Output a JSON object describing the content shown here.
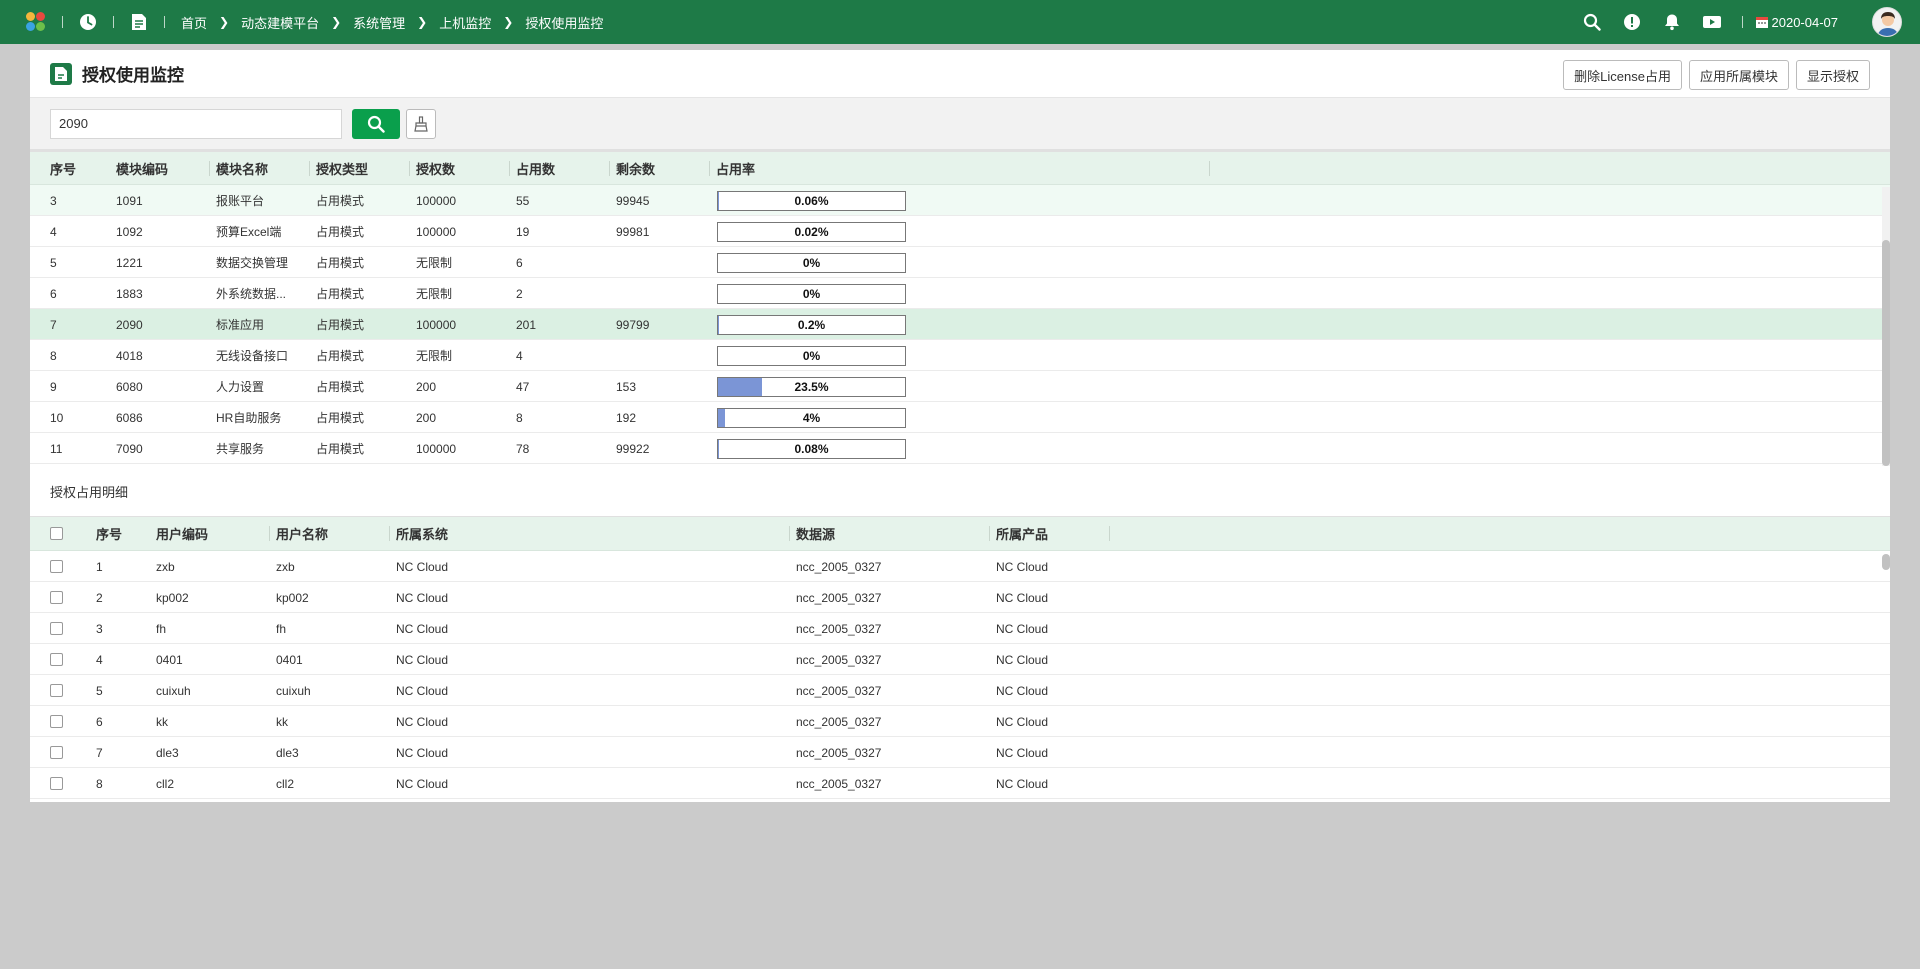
{
  "topbar": {
    "breadcrumbs": [
      "首页",
      "动态建模平台",
      "系统管理",
      "上机监控",
      "授权使用监控"
    ],
    "date": "2020-04-07",
    "icons": [
      "clock-icon",
      "document-icon",
      "search-icon",
      "alert-icon",
      "bell-icon",
      "video-icon",
      "calendar-icon"
    ]
  },
  "header": {
    "title": "授权使用监控",
    "buttons": [
      "删除License占用",
      "应用所属模块",
      "显示授权"
    ]
  },
  "search": {
    "value": "2090"
  },
  "license_table": {
    "columns": [
      "序号",
      "模块编码",
      "模块名称",
      "授权类型",
      "授权数",
      "占用数",
      "剩余数",
      "占用率"
    ],
    "rows": [
      {
        "no": "3",
        "code": "1091",
        "name": "报账平台",
        "type": "占用模式",
        "licensed": "100000",
        "used": "55",
        "remaining": "99945",
        "rate": "0.06%",
        "rate_value": 0.06
      },
      {
        "no": "4",
        "code": "1092",
        "name": "预算Excel端",
        "type": "占用模式",
        "licensed": "100000",
        "used": "19",
        "remaining": "99981",
        "rate": "0.02%",
        "rate_value": 0.02
      },
      {
        "no": "5",
        "code": "1221",
        "name": "数据交换管理",
        "type": "占用模式",
        "licensed": "无限制",
        "used": "6",
        "remaining": "",
        "rate": "0%",
        "rate_value": 0
      },
      {
        "no": "6",
        "code": "1883",
        "name": "外系统数据...",
        "type": "占用模式",
        "licensed": "无限制",
        "used": "2",
        "remaining": "",
        "rate": "0%",
        "rate_value": 0
      },
      {
        "no": "7",
        "code": "2090",
        "name": "标准应用",
        "type": "占用模式",
        "licensed": "100000",
        "used": "201",
        "remaining": "99799",
        "rate": "0.2%",
        "rate_value": 0.2
      },
      {
        "no": "8",
        "code": "4018",
        "name": "无线设备接口",
        "type": "占用模式",
        "licensed": "无限制",
        "used": "4",
        "remaining": "",
        "rate": "0%",
        "rate_value": 0
      },
      {
        "no": "9",
        "code": "6080",
        "name": "人力设置",
        "type": "占用模式",
        "licensed": "200",
        "used": "47",
        "remaining": "153",
        "rate": "23.5%",
        "rate_value": 23.5
      },
      {
        "no": "10",
        "code": "6086",
        "name": "HR自助服务",
        "type": "占用模式",
        "licensed": "200",
        "used": "8",
        "remaining": "192",
        "rate": "4%",
        "rate_value": 4
      },
      {
        "no": "11",
        "code": "7090",
        "name": "共享服务",
        "type": "占用模式",
        "licensed": "100000",
        "used": "78",
        "remaining": "99922",
        "rate": "0.08%",
        "rate_value": 0.08
      }
    ],
    "selected_row": "7",
    "hover_row": "3"
  },
  "detail": {
    "title": "授权占用明细",
    "columns": [
      "序号",
      "用户编码",
      "用户名称",
      "所属系统",
      "数据源",
      "所属产品"
    ],
    "rows": [
      {
        "no": "1",
        "code": "zxb",
        "name": "zxb",
        "system": "NC Cloud",
        "datasource": "ncc_2005_0327",
        "product": "NC Cloud"
      },
      {
        "no": "2",
        "code": "kp002",
        "name": "kp002",
        "system": "NC Cloud",
        "datasource": "ncc_2005_0327",
        "product": "NC Cloud"
      },
      {
        "no": "3",
        "code": "fh",
        "name": "fh",
        "system": "NC Cloud",
        "datasource": "ncc_2005_0327",
        "product": "NC Cloud"
      },
      {
        "no": "4",
        "code": "0401",
        "name": "0401",
        "system": "NC Cloud",
        "datasource": "ncc_2005_0327",
        "product": "NC Cloud"
      },
      {
        "no": "5",
        "code": "cuixuh",
        "name": "cuixuh",
        "system": "NC Cloud",
        "datasource": "ncc_2005_0327",
        "product": "NC Cloud"
      },
      {
        "no": "6",
        "code": "kk",
        "name": "kk",
        "system": "NC Cloud",
        "datasource": "ncc_2005_0327",
        "product": "NC Cloud"
      },
      {
        "no": "7",
        "code": "dle3",
        "name": "dle3",
        "system": "NC Cloud",
        "datasource": "ncc_2005_0327",
        "product": "NC Cloud"
      },
      {
        "no": "8",
        "code": "cll2",
        "name": "cll2",
        "system": "NC Cloud",
        "datasource": "ncc_2005_0327",
        "product": "NC Cloud"
      }
    ]
  },
  "colors": {
    "topbar": "#1e7a47",
    "accent": "#0a9f4c",
    "header_bg": "#e6f3eb",
    "selected_row": "#dbf0e3",
    "progress_fill": "#7b95d6"
  }
}
